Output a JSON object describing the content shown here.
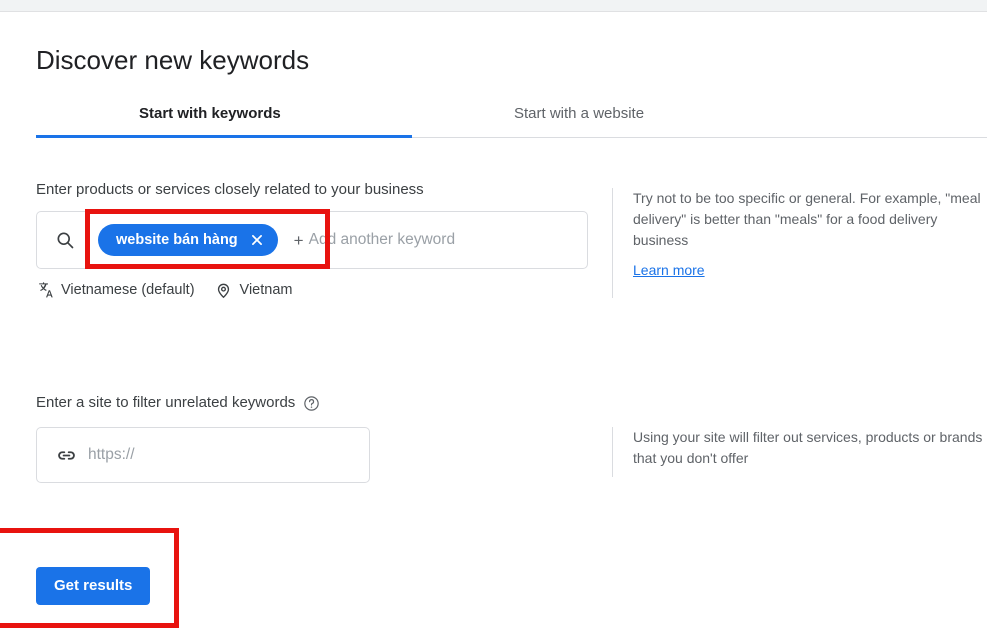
{
  "page": {
    "title": "Discover new keywords"
  },
  "tabs": [
    {
      "label": "Start with keywords",
      "active": true
    },
    {
      "label": "Start with a website",
      "active": false
    }
  ],
  "keywords_section": {
    "label": "Enter products or services closely related to your business",
    "search_icon": "search-icon",
    "chips": [
      {
        "label": "website bán hàng",
        "close_icon": "close-icon"
      }
    ],
    "add_plus": "+",
    "add_placeholder": "Add another keyword",
    "meta": [
      {
        "icon": "translate-icon",
        "text": "Vietnamese (default)"
      },
      {
        "icon": "location-pin-icon",
        "text": "Vietnam"
      }
    ],
    "help_text": "Try not to be too specific or general. For example, \"meal delivery\" is better than \"meals\" for a food delivery business",
    "help_link": "Learn more"
  },
  "site_section": {
    "label": "Enter a site to filter unrelated keywords",
    "help_icon": "help-circle-icon",
    "link_icon": "link-icon",
    "placeholder": "https://",
    "value": "",
    "help_text": "Using your site will filter out services, products or brands that you don't offer"
  },
  "actions": {
    "get_results": "Get results"
  },
  "colors": {
    "accent": "#1a73e8",
    "annotation": "#e8130f",
    "text_primary": "#202124",
    "text_secondary": "#5f6368",
    "placeholder": "#9aa0a6",
    "border": "#dadce0",
    "top_strip": "#f1f3f4"
  }
}
